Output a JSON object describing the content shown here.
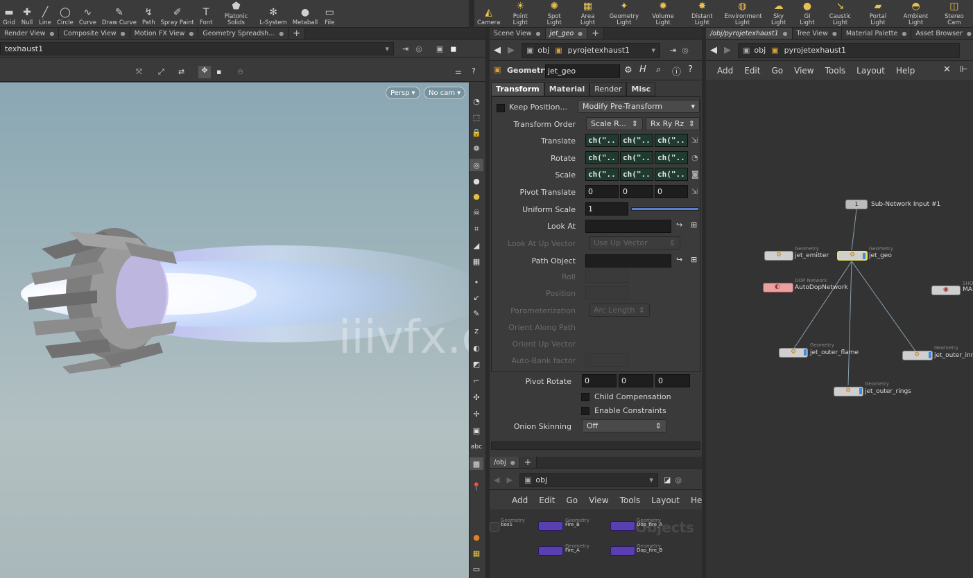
{
  "shelf_left": [
    {
      "label": "Grid",
      "icon": "grid-icon"
    },
    {
      "label": "Null",
      "icon": "null-icon"
    },
    {
      "label": "Line",
      "icon": "line-icon"
    },
    {
      "label": "Circle",
      "icon": "circle-icon"
    },
    {
      "label": "Curve",
      "icon": "curve-icon"
    },
    {
      "label": "Draw Curve",
      "icon": "draw-curve-icon"
    },
    {
      "label": "Path",
      "icon": "path-icon"
    },
    {
      "label": "Spray Paint",
      "icon": "spray-paint-icon"
    },
    {
      "label": "Font",
      "icon": "font-icon"
    },
    {
      "label": "Platonic Solids",
      "icon": "platonic-icon"
    },
    {
      "label": "L-System",
      "icon": "lsystem-icon"
    },
    {
      "label": "Metaball",
      "icon": "metaball-icon"
    },
    {
      "label": "File",
      "icon": "file-icon"
    }
  ],
  "shelf_right": [
    {
      "label": "Camera",
      "icon": "camera-icon"
    },
    {
      "label": "Point Light",
      "icon": "point-light-icon"
    },
    {
      "label": "Spot Light",
      "icon": "spot-light-icon"
    },
    {
      "label": "Area Light",
      "icon": "area-light-icon"
    },
    {
      "label": "Geometry Light",
      "icon": "geometry-light-icon"
    },
    {
      "label": "Volume Light",
      "icon": "volume-light-icon"
    },
    {
      "label": "Distant Light",
      "icon": "distant-light-icon"
    },
    {
      "label": "Environment Light",
      "icon": "environment-light-icon"
    },
    {
      "label": "Sky Light",
      "icon": "sky-light-icon"
    },
    {
      "label": "GI Light",
      "icon": "gi-light-icon"
    },
    {
      "label": "Caustic Light",
      "icon": "caustic-light-icon"
    },
    {
      "label": "Portal Light",
      "icon": "portal-light-icon"
    },
    {
      "label": "Ambient Light",
      "icon": "ambient-light-icon"
    },
    {
      "label": "Stereo Cam",
      "icon": "stereo-camera-icon"
    }
  ],
  "left_tabs": [
    "Render View",
    "Composite View",
    "Motion FX View",
    "Geometry Spreadsh..."
  ],
  "left_path": "texhaust1",
  "viewport": {
    "persp": "Persp",
    "cam": "No cam",
    "watermark": "iiivfx.com"
  },
  "mid_tabs": [
    "Scene View",
    "jet_geo"
  ],
  "mid_path": {
    "root": "obj",
    "node": "pyrojetexhaust1"
  },
  "params": {
    "type": "Geometry",
    "name": "jet_geo",
    "tabs": [
      "Transform",
      "Material",
      "Render",
      "Misc"
    ],
    "keep_position": "Keep Position...",
    "keep_mode": "Modify Pre-Transform",
    "transform_order": "Transform Order",
    "order_a": "Scale R...",
    "order_b": "Rx Ry Rz",
    "translate": "Translate",
    "rotate": "Rotate",
    "scale": "Scale",
    "expr": "ch(\"..",
    "pivot_translate": "Pivot Translate",
    "zero": "0",
    "uniform_scale": "Uniform Scale",
    "uniform_value": "1",
    "look_at": "Look At",
    "look_up": "Look At Up Vector",
    "look_up_mode": "Use Up Vector",
    "path_object": "Path Object",
    "roll": "Roll",
    "position": "Position",
    "parameterization": "Parameterization",
    "param_mode": "Arc Length",
    "orient_along": "Orient Along Path",
    "orient_up": "Orient Up Vector",
    "auto_bank": "Auto-Bank factor",
    "pivot_rotate": "Pivot Rotate",
    "child_comp": "Child Compensation",
    "enable_constraints": "Enable Constraints",
    "onion": "Onion Skinning",
    "onion_mode": "Off"
  },
  "bottom_tabs": [
    "/obj"
  ],
  "bottom_path": "obj",
  "bottom_menu": [
    "Add",
    "Edit",
    "Go",
    "View",
    "Tools",
    "Layout",
    "Help"
  ],
  "obj_nodes": [
    {
      "type": "Geometry",
      "name": "box1"
    },
    {
      "type": "Geometry",
      "name": "Fire_B"
    },
    {
      "type": "Geometry",
      "name": "Dop_fire_A"
    },
    {
      "type": "Geometry",
      "name": "Fire_A"
    },
    {
      "type": "Geometry",
      "name": "Dop_fire_B"
    }
  ],
  "objects_watermark": "Objects",
  "right_tabs": [
    "/obj/pyrojetexhaust1",
    "Tree View",
    "Material Palette",
    "Asset Browser"
  ],
  "right_path": {
    "root": "obj",
    "node": "pyrojetexhaust1"
  },
  "right_menu": [
    "Add",
    "Edit",
    "Go",
    "View",
    "Tools",
    "Layout",
    "Help"
  ],
  "network": {
    "subnet_input": "Sub-Network Input #1",
    "subnet_num": "1",
    "emitter": {
      "type": "Geometry",
      "name": "jet_emitter"
    },
    "geo": {
      "type": "Geometry",
      "name": "jet_geo"
    },
    "dop": {
      "type": "DOP Network",
      "name": "AutoDopNetwork"
    },
    "mat": {
      "type": "SHOP",
      "name": "MA"
    },
    "flame": {
      "type": "Geometry",
      "name": "jet_outer_flame"
    },
    "inner": {
      "type": "Geometry",
      "name": "jet_outer_inne"
    },
    "rings": {
      "type": "Geometry",
      "name": "jet_outer_rings"
    }
  }
}
